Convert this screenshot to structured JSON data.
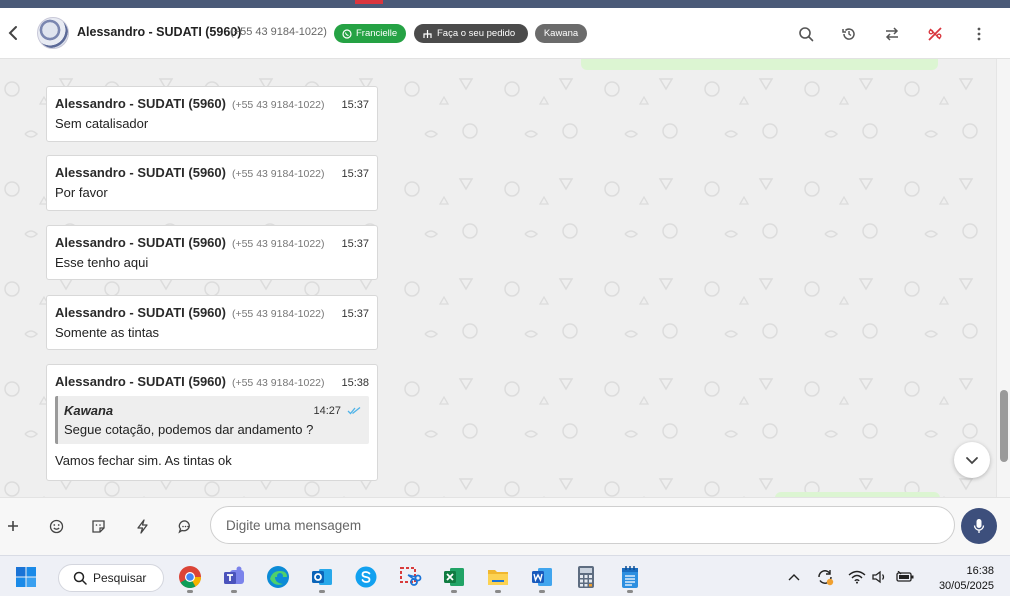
{
  "header": {
    "contact_name": "Alessandro - SUDATI (5960)",
    "contact_phone": "(+55 43 9184-1022)",
    "badges": [
      "Francielle",
      "Faça o seu pedido",
      "Kawana"
    ]
  },
  "messages": [
    {
      "sender": "Alessandro - SUDATI (5960)",
      "phone": "(+55 43 9184-1022)",
      "time": "15:37",
      "text": "Sem catalisador"
    },
    {
      "sender": "Alessandro - SUDATI (5960)",
      "phone": "(+55 43 9184-1022)",
      "time": "15:37",
      "text": "Por favor"
    },
    {
      "sender": "Alessandro - SUDATI (5960)",
      "phone": "(+55 43 9184-1022)",
      "time": "15:37",
      "text": "Esse tenho aqui"
    },
    {
      "sender": "Alessandro - SUDATI (5960)",
      "phone": "(+55 43 9184-1022)",
      "time": "15:37",
      "text": "Somente as tintas"
    },
    {
      "sender": "Alessandro - SUDATI (5960)",
      "phone": "(+55 43 9184-1022)",
      "time": "15:38",
      "text": "Vamos fechar sim. As tintas ok",
      "quote": {
        "name": "Kawana",
        "time": "14:27",
        "text": "Segue cotação, podemos dar andamento ?"
      }
    }
  ],
  "composer": {
    "placeholder": "Digite uma mensagem"
  },
  "taskbar": {
    "search_label": "Pesquisar",
    "time": "16:38",
    "date": "30/05/2025"
  },
  "colors": {
    "accent": "#3d4f7c",
    "green_badge": "#25a244",
    "dark_badge": "#4b4b4b",
    "gray_badge": "#6b6b6b",
    "read_check": "#4fb3e8"
  }
}
